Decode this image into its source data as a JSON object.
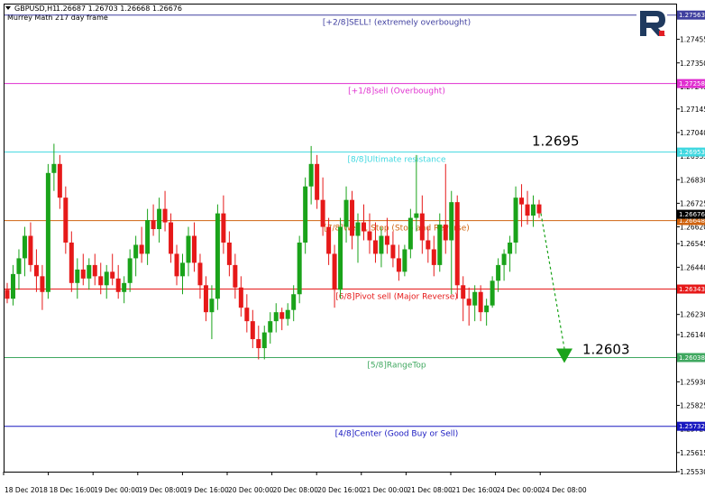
{
  "header": {
    "symbol": "GBPUSD,H1",
    "ohlc": "1.26687 1.26703 1.26668 1.26676",
    "indicator": "Murrey Math 217 day frame",
    "expand_icon": "triangle-down-icon"
  },
  "logo": {
    "name": "roboforex-logo",
    "color": "#1f3a5f",
    "accent": "#e31e24"
  },
  "chart_data": {
    "type": "candlestick",
    "ylim": [
      1.2553,
      1.2761
    ],
    "y_ticks": [
      "1.27560",
      "1.27455",
      "1.27350",
      "1.27245",
      "1.27145",
      "1.27040",
      "1.26935",
      "1.26830",
      "1.26725",
      "1.26620",
      "1.26545",
      "1.26440",
      "1.26335",
      "1.26230",
      "1.26140",
      "1.26035",
      "1.25930",
      "1.25825",
      "1.25720",
      "1.25615",
      "1.25530"
    ],
    "x_ticks": [
      "18 Dec 2018",
      "18 Dec 16:00",
      "19 Dec 00:00",
      "19 Dec 08:00",
      "19 Dec 16:00",
      "20 Dec 00:00",
      "20 Dec 08:00",
      "20 Dec 16:00",
      "21 Dec 00:00",
      "21 Dec 08:00",
      "21 Dec 16:00",
      "24 Dec 00:00",
      "24 Dec 08:00"
    ],
    "bull_color": "#1aa31a",
    "bear_color": "#e61919",
    "candles": [
      [
        1.2634,
        1.2637,
        1.2628,
        1.263
      ],
      [
        1.263,
        1.2645,
        1.2627,
        1.2641
      ],
      [
        1.2641,
        1.2652,
        1.2634,
        1.2648
      ],
      [
        1.2648,
        1.2662,
        1.264,
        1.2658
      ],
      [
        1.2658,
        1.2664,
        1.2642,
        1.2645
      ],
      [
        1.2645,
        1.2652,
        1.2633,
        1.264
      ],
      [
        1.264,
        1.2645,
        1.2625,
        1.2633
      ],
      [
        1.2633,
        1.269,
        1.263,
        1.2686
      ],
      [
        1.2686,
        1.2699,
        1.2678,
        1.269
      ],
      [
        1.269,
        1.2694,
        1.267,
        1.2675
      ],
      [
        1.2675,
        1.268,
        1.265,
        1.2655
      ],
      [
        1.2655,
        1.266,
        1.2633,
        1.2637
      ],
      [
        1.2637,
        1.2648,
        1.263,
        1.2643
      ],
      [
        1.2643,
        1.265,
        1.2636,
        1.2639
      ],
      [
        1.2639,
        1.2648,
        1.2634,
        1.2645
      ],
      [
        1.2645,
        1.265,
        1.2636,
        1.264
      ],
      [
        1.264,
        1.2646,
        1.2632,
        1.2636
      ],
      [
        1.2636,
        1.2645,
        1.263,
        1.2642
      ],
      [
        1.2642,
        1.265,
        1.2636,
        1.2639
      ],
      [
        1.2639,
        1.2645,
        1.263,
        1.2633
      ],
      [
        1.2633,
        1.264,
        1.2628,
        1.2637
      ],
      [
        1.2637,
        1.2652,
        1.2633,
        1.2648
      ],
      [
        1.2648,
        1.2658,
        1.264,
        1.2654
      ],
      [
        1.2654,
        1.2662,
        1.2646,
        1.265
      ],
      [
        1.265,
        1.267,
        1.2645,
        1.2665
      ],
      [
        1.2665,
        1.2672,
        1.2658,
        1.2661
      ],
      [
        1.2661,
        1.2675,
        1.2655,
        1.267
      ],
      [
        1.267,
        1.2678,
        1.266,
        1.2664
      ],
      [
        1.2664,
        1.2668,
        1.2646,
        1.265
      ],
      [
        1.265,
        1.2654,
        1.2636,
        1.264
      ],
      [
        1.264,
        1.265,
        1.2632,
        1.2646
      ],
      [
        1.2646,
        1.2662,
        1.264,
        1.2658
      ],
      [
        1.2658,
        1.2664,
        1.2642,
        1.2646
      ],
      [
        1.2646,
        1.265,
        1.263,
        1.2636
      ],
      [
        1.2636,
        1.264,
        1.262,
        1.2624
      ],
      [
        1.2624,
        1.2636,
        1.2612,
        1.263
      ],
      [
        1.263,
        1.2672,
        1.2625,
        1.2668
      ],
      [
        1.2668,
        1.2676,
        1.265,
        1.2655
      ],
      [
        1.2655,
        1.266,
        1.264,
        1.2645
      ],
      [
        1.2645,
        1.265,
        1.263,
        1.2635
      ],
      [
        1.2635,
        1.264,
        1.2622,
        1.2626
      ],
      [
        1.2626,
        1.2632,
        1.2615,
        1.262
      ],
      [
        1.262,
        1.2625,
        1.2608,
        1.2612
      ],
      [
        1.2612,
        1.2618,
        1.2603,
        1.2608
      ],
      [
        1.2608,
        1.2618,
        1.2603,
        1.2615
      ],
      [
        1.2615,
        1.2624,
        1.261,
        1.262
      ],
      [
        1.262,
        1.2628,
        1.2615,
        1.2624
      ],
      [
        1.2624,
        1.2626,
        1.2616,
        1.2621
      ],
      [
        1.2621,
        1.2628,
        1.2618,
        1.2625
      ],
      [
        1.2625,
        1.2636,
        1.262,
        1.2632
      ],
      [
        1.2632,
        1.2658,
        1.2628,
        1.2655
      ],
      [
        1.2655,
        1.2684,
        1.265,
        1.268
      ],
      [
        1.268,
        1.2698,
        1.2672,
        1.269
      ],
      [
        1.269,
        1.2694,
        1.267,
        1.2674
      ],
      [
        1.2674,
        1.2684,
        1.2658,
        1.2662
      ],
      [
        1.2662,
        1.2666,
        1.2645,
        1.265
      ],
      [
        1.265,
        1.2654,
        1.2626,
        1.2634
      ],
      [
        1.2634,
        1.2666,
        1.263,
        1.2662
      ],
      [
        1.2662,
        1.268,
        1.2655,
        1.2674
      ],
      [
        1.2674,
        1.2678,
        1.2652,
        1.2658
      ],
      [
        1.2658,
        1.2668,
        1.2646,
        1.2664
      ],
      [
        1.2664,
        1.2672,
        1.2656,
        1.266
      ],
      [
        1.266,
        1.2668,
        1.265,
        1.2656
      ],
      [
        1.2656,
        1.2664,
        1.2646,
        1.265
      ],
      [
        1.265,
        1.2662,
        1.2644,
        1.2658
      ],
      [
        1.2658,
        1.2666,
        1.265,
        1.2654
      ],
      [
        1.2654,
        1.266,
        1.2644,
        1.2648
      ],
      [
        1.2648,
        1.2654,
        1.2638,
        1.2642
      ],
      [
        1.2642,
        1.2654,
        1.264,
        1.2652
      ],
      [
        1.2652,
        1.267,
        1.2648,
        1.2666
      ],
      [
        1.2666,
        1.2694,
        1.266,
        1.2668
      ],
      [
        1.2668,
        1.2676,
        1.265,
        1.2656
      ],
      [
        1.2656,
        1.2662,
        1.2646,
        1.2652
      ],
      [
        1.2652,
        1.2658,
        1.264,
        1.2645
      ],
      [
        1.2645,
        1.2668,
        1.2642,
        1.2663
      ],
      [
        1.2663,
        1.269,
        1.265,
        1.2656
      ],
      [
        1.2656,
        1.2678,
        1.2632,
        1.2673
      ],
      [
        1.2673,
        1.2676,
        1.263,
        1.2636
      ],
      [
        1.2636,
        1.264,
        1.262,
        1.263
      ],
      [
        1.263,
        1.2635,
        1.2618,
        1.2627
      ],
      [
        1.2627,
        1.2636,
        1.262,
        1.2633
      ],
      [
        1.2633,
        1.2636,
        1.262,
        1.2624
      ],
      [
        1.2624,
        1.263,
        1.2618,
        1.2627
      ],
      [
        1.2627,
        1.264,
        1.2626,
        1.2638
      ],
      [
        1.2638,
        1.2648,
        1.2633,
        1.2645
      ],
      [
        1.2645,
        1.2652,
        1.2638,
        1.265
      ],
      [
        1.265,
        1.2658,
        1.2642,
        1.2655
      ],
      [
        1.2655,
        1.268,
        1.265,
        1.2675
      ],
      [
        1.2675,
        1.2681,
        1.2662,
        1.2672
      ],
      [
        1.2672,
        1.2678,
        1.2663,
        1.2667
      ],
      [
        1.2667,
        1.2676,
        1.2662,
        1.2672
      ],
      [
        1.2672,
        1.2674,
        1.2666,
        1.2668
      ]
    ],
    "levels": [
      {
        "label": "[+2/8]SELL! (extremely overbought)",
        "value": 1.27563,
        "price": "1.27563",
        "color": "#4040a0"
      },
      {
        "label": "[+1/8]sell (Overbought)",
        "value": 1.27258,
        "price": "1.27258",
        "color": "#e030d0"
      },
      {
        "label": "[8/8]Ultimate resistance",
        "value": 1.26953,
        "price": "1.26953",
        "color": "#40d8e0"
      },
      {
        "label": "[7/8]Weak, Stop (Stop and Reverse)",
        "value": 1.26648,
        "price": "1.26648",
        "color": "#d06410"
      },
      {
        "label": "[6/8]Pivot sell (Major Reverse)",
        "value": 1.26343,
        "price": "1.26343",
        "color": "#e61919"
      },
      {
        "label": "[5/8]RangeTop",
        "value": 1.26038,
        "price": "1.26038",
        "color": "#40a860"
      },
      {
        "label": "[4/8]Center (Good Buy or Sell)",
        "value": 1.25732,
        "price": "1.25732",
        "color": "#1818c0"
      }
    ],
    "current_price": {
      "value": 1.26676,
      "price": "1.26676"
    },
    "annotations": [
      {
        "text": "1.2695",
        "value": 1.2695
      },
      {
        "text": "1.2603",
        "value": 1.2603
      }
    ],
    "forecast": {
      "from_value": 1.2668,
      "to_value": 1.2603,
      "color": "#1aa31a"
    }
  }
}
